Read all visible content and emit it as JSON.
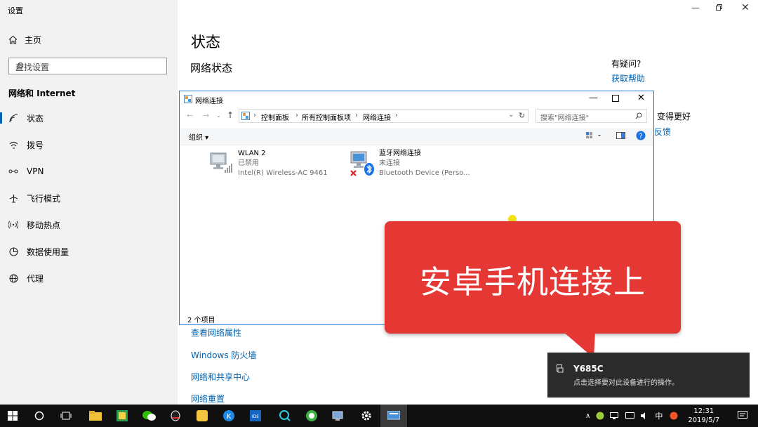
{
  "settings": {
    "window_title": "设置",
    "home_label": "主页",
    "search_placeholder": "查找设置",
    "section_title": "网络和 Internet",
    "nav_items": [
      {
        "label": "状态",
        "icon": "home-status-icon"
      },
      {
        "label": "拨号",
        "icon": "dialup-icon"
      },
      {
        "label": "VPN",
        "icon": "vpn-icon"
      },
      {
        "label": "飞行模式",
        "icon": "airplane-icon"
      },
      {
        "label": "移动热点",
        "icon": "hotspot-icon"
      },
      {
        "label": "数据使用量",
        "icon": "data-usage-icon"
      },
      {
        "label": "代理",
        "icon": "globe-icon"
      }
    ],
    "page_title": "状态",
    "subtitle": "网络状态",
    "help_question": "有疑问?",
    "help_link": "获取帮助",
    "improve_text": "变得更好",
    "feedback_link": "反馈",
    "links": [
      "查看网络属性",
      "Windows 防火墙",
      "网络和共享中心",
      "网络重置"
    ]
  },
  "explorer": {
    "title": "网络连接",
    "breadcrumb": [
      "控制面板",
      "所有控制面板项",
      "网络连接"
    ],
    "search_placeholder": "搜索\"网络连接\"",
    "organize_label": "组织 ▾",
    "adapters": [
      {
        "name": "WLAN 2",
        "status": "已禁用",
        "device": "Intel(R) Wireless-AC 9461"
      },
      {
        "name": "蓝牙网络连接",
        "status": "未连接",
        "device": "Bluetooth Device (Perso..."
      }
    ],
    "status_bar": "2 个项目"
  },
  "banner": {
    "text": "安卓手机连接上",
    "color": "#e53835"
  },
  "toast": {
    "title": "Y685C",
    "message": "点击选择要对此设备进行的操作。"
  },
  "taskbar": {
    "time": "12:31",
    "date": "2019/5/7",
    "ime": "中"
  },
  "colors": {
    "accent": "#0063b1",
    "taskbar": "#101010"
  }
}
